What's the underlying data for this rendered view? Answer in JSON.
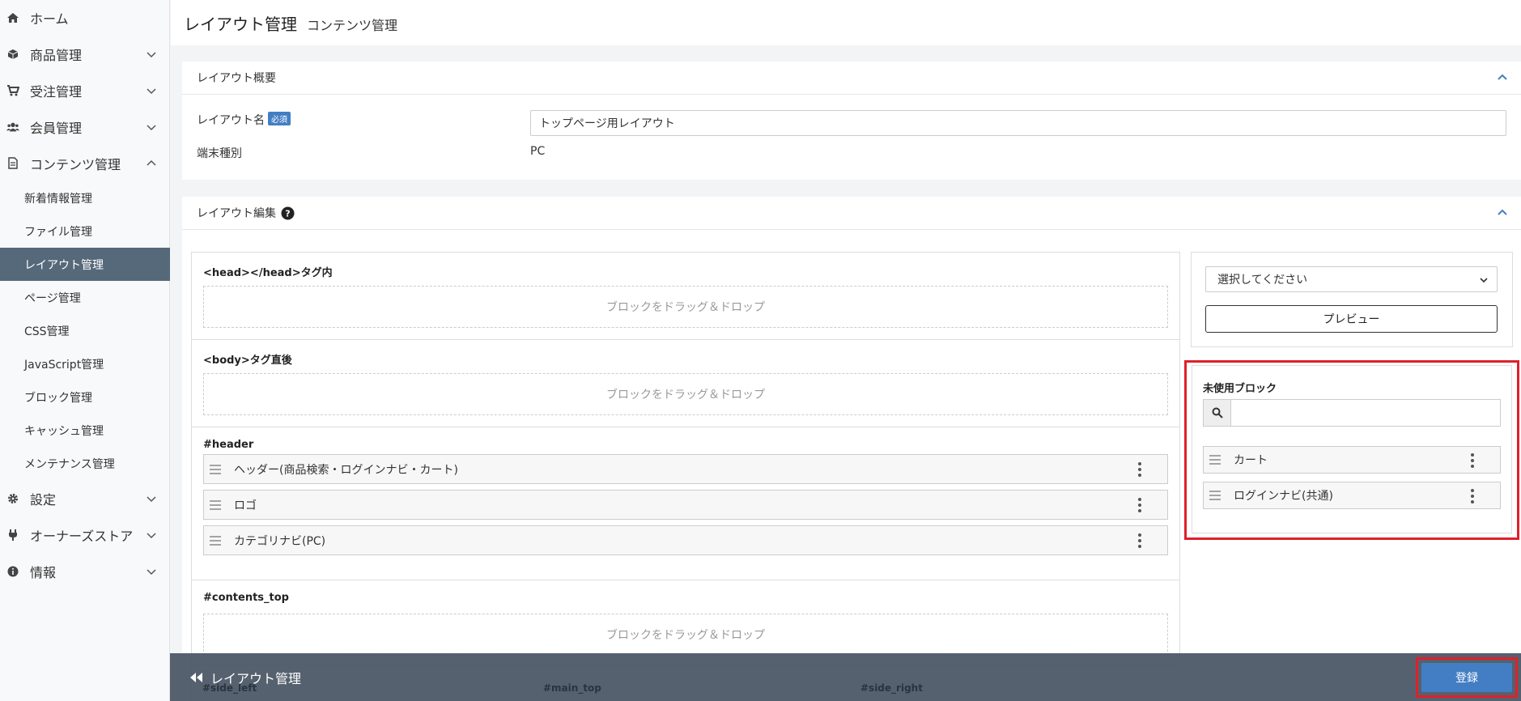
{
  "sidebar": {
    "items": [
      {
        "label": "ホーム"
      },
      {
        "label": "商品管理"
      },
      {
        "label": "受注管理"
      },
      {
        "label": "会員管理"
      },
      {
        "label": "コンテンツ管理"
      }
    ],
    "content_sub": [
      {
        "label": "新着情報管理"
      },
      {
        "label": "ファイル管理"
      },
      {
        "label": "レイアウト管理"
      },
      {
        "label": "ページ管理"
      },
      {
        "label": "CSS管理"
      },
      {
        "label": "JavaScript管理"
      },
      {
        "label": "ブロック管理"
      },
      {
        "label": "キャッシュ管理"
      },
      {
        "label": "メンテナンス管理"
      }
    ],
    "bottom_items": [
      {
        "label": "設定"
      },
      {
        "label": "オーナーズストア"
      },
      {
        "label": "情報"
      }
    ]
  },
  "header": {
    "title": "レイアウト管理",
    "subtitle": "コンテンツ管理"
  },
  "overview": {
    "title": "レイアウト概要",
    "name_label": "レイアウト名",
    "required_badge": "必須",
    "name_value": "トップページ用レイアウト",
    "device_label": "端末種別",
    "device_value": "PC"
  },
  "editor": {
    "title": "レイアウト編集",
    "dropzone_text": "ブロックをドラッグ＆ドロップ",
    "head_section": "<head></head>タグ内",
    "body_section": "<body>タグ直後",
    "header_section": "#header",
    "header_blocks": [
      {
        "label": "ヘッダー(商品検索・ログインナビ・カート)"
      },
      {
        "label": "ロゴ"
      },
      {
        "label": "カテゴリナビ(PC)"
      }
    ],
    "contents_top_section": "#contents_top",
    "side_left": "#side_left",
    "main_top": "#main_top",
    "side_right": "#side_right"
  },
  "right_panel": {
    "select_value": "選択してください",
    "preview_label": "プレビュー",
    "unused_title": "未使用ブロック",
    "search_placeholder": "",
    "unused_blocks": [
      {
        "label": "カート"
      },
      {
        "label": "ログインナビ(共通)"
      }
    ]
  },
  "footer": {
    "back_label": "レイアウト管理",
    "register_label": "登録"
  },
  "colors": {
    "accent": "#437ec4",
    "highlight": "#e0202a",
    "sidebar_active": "#56697a"
  }
}
